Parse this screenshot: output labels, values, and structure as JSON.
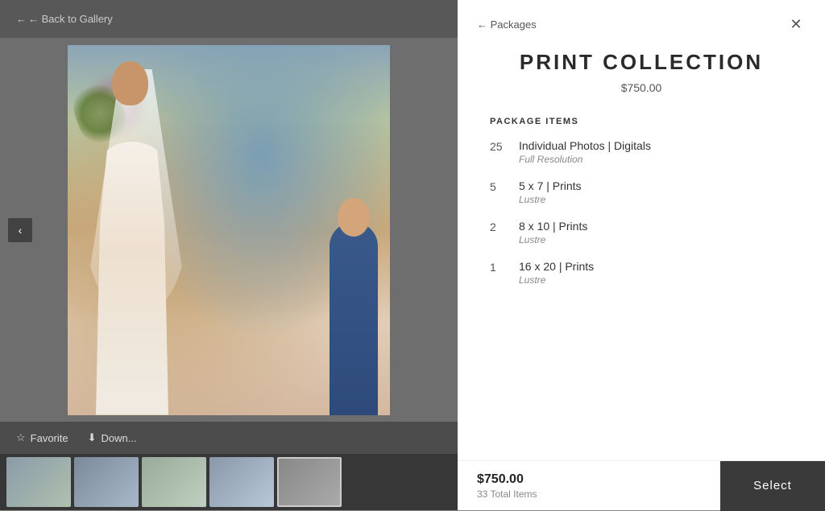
{
  "gallery": {
    "back_label": "← Back to Gallery",
    "left_arrow": "‹",
    "favorite_label": "Favorite",
    "download_label": "Down...",
    "thumbnails": [
      {
        "id": 1,
        "class": "thumb-1"
      },
      {
        "id": 2,
        "class": "thumb-2"
      },
      {
        "id": 3,
        "class": "thumb-3"
      },
      {
        "id": 4,
        "class": "thumb-4"
      },
      {
        "id": 5,
        "class": "thumb-5"
      }
    ]
  },
  "panel": {
    "back_label": "← Packages",
    "close_icon": "✕",
    "title": "PRINT COLLECTION",
    "price": "$750.00",
    "section_label": "PACKAGE ITEMS",
    "items": [
      {
        "qty": "25",
        "name": "Individual Photos | Digitals",
        "sub": "Full Resolution"
      },
      {
        "qty": "5",
        "name": "5 x 7 | Prints",
        "sub": "Lustre"
      },
      {
        "qty": "2",
        "name": "8 x 10 | Prints",
        "sub": "Lustre"
      },
      {
        "qty": "1",
        "name": "16 x 20 | Prints",
        "sub": "Lustre"
      }
    ],
    "footer": {
      "price": "$750.00",
      "total_items": "33 Total Items",
      "select_label": "Select"
    }
  }
}
